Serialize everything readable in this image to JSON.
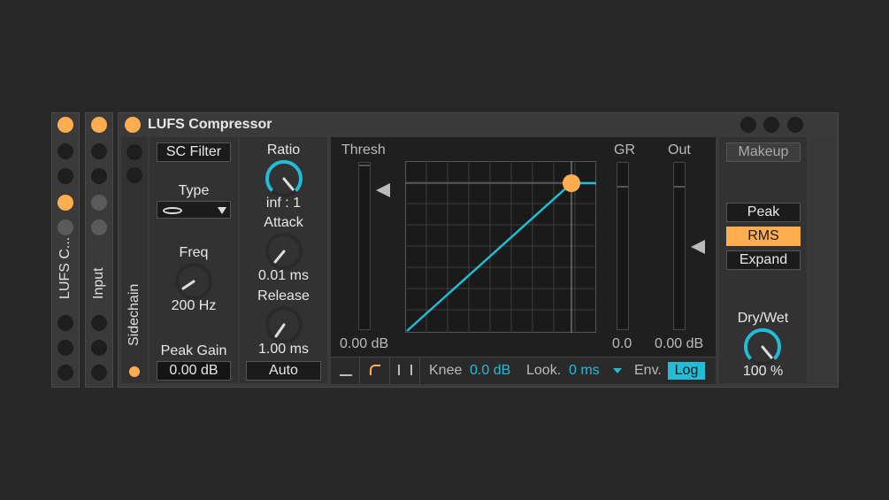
{
  "strip1": {
    "title": "LUFS C..."
  },
  "strip2": {
    "title": "Input"
  },
  "device": {
    "title": "LUFS Compressor",
    "sidechain_label": "Sidechain",
    "sc_filter_label": "SC Filter",
    "type_label": "Type",
    "freq_label": "Freq",
    "freq_value": "200 Hz",
    "peak_gain_label": "Peak Gain",
    "peak_gain_value": "0.00 dB",
    "ratio_label": "Ratio",
    "ratio_value": "inf : 1",
    "attack_label": "Attack",
    "attack_value": "0.01 ms",
    "release_label": "Release",
    "release_value": "1.00 ms",
    "auto_label": "Auto",
    "thresh_label": "Thresh",
    "thresh_value": "0.00 dB",
    "gr_label": "GR",
    "gr_value": "0.0",
    "out_label": "Out",
    "out_value": "0.00 dB",
    "knee_label": "Knee",
    "knee_value": "0.0 dB",
    "look_label": "Look.",
    "look_value": "0 ms",
    "env_label": "Env.",
    "env_value": "Log",
    "makeup_label": "Makeup",
    "mode_peak": "Peak",
    "mode_rms": "RMS",
    "mode_expand": "Expand",
    "drywet_label": "Dry/Wet",
    "drywet_value": "100 %"
  },
  "colors": {
    "accent": "#ffae4f",
    "cyan": "#22bcd7",
    "bg": "#282828"
  },
  "knobs": {
    "freq_level": 0.35,
    "ratio_level": 1.0,
    "attack_level": 0.0,
    "release_level": 0.05,
    "drywet_level": 1.0
  }
}
